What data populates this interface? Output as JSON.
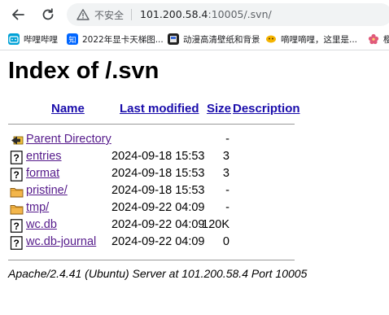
{
  "browser": {
    "insecure_label": "不安全",
    "url_host": "101.200.58.4",
    "url_path": ":10005/.svn/"
  },
  "bookmarks": [
    {
      "label": "哔哩哔哩",
      "icon": "bilibili-icon",
      "color": "#00a1d6"
    },
    {
      "label": "2022年显卡天梯图...",
      "icon": "zhihu-icon",
      "color": "#0066ff"
    },
    {
      "label": "动漫高清壁纸和背景",
      "icon": "wallpaper-icon",
      "color": "#222222"
    },
    {
      "label": "嘀哩嘀哩，这里是...",
      "icon": "dilidili-icon",
      "color": "#f5b400"
    },
    {
      "label": "樱",
      "icon": "sakura-icon",
      "color": "#e05a7a"
    }
  ],
  "page": {
    "title": "Index of /.svn",
    "columns": {
      "name": "Name",
      "last_modified": "Last modified",
      "size": "Size",
      "description": "Description"
    },
    "parent": {
      "name": "Parent Directory",
      "size": "-"
    },
    "entries": [
      {
        "name": "entries",
        "modified": "2024-09-18 15:53",
        "size": "3",
        "type": "file"
      },
      {
        "name": "format",
        "modified": "2024-09-18 15:53",
        "size": "3",
        "type": "file"
      },
      {
        "name": "pristine/",
        "modified": "2024-09-18 15:53",
        "size": "-",
        "type": "folder"
      },
      {
        "name": "tmp/",
        "modified": "2024-09-22 04:09",
        "size": "-",
        "type": "folder"
      },
      {
        "name": "wc.db",
        "modified": "2024-09-22 04:09",
        "size": "120K",
        "type": "file"
      },
      {
        "name": "wc.db-journal",
        "modified": "2024-09-22 04:09",
        "size": "0",
        "type": "file"
      }
    ],
    "footer": "Apache/2.4.41 (Ubuntu) Server at 101.200.58.4 Port 10005"
  }
}
